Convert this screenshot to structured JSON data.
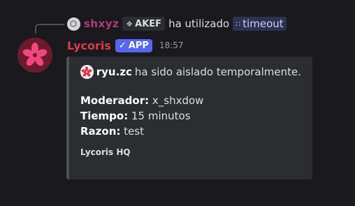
{
  "reply": {
    "username": "shxyz",
    "tag": "AKEF",
    "action_text": "ha utilizado",
    "command": "timeout",
    "avatar_icon": "user-avatar",
    "tag_icon": "clan-tag-icon",
    "command_icon": "slash-command-icon"
  },
  "message": {
    "username": "Lycoris",
    "app_badge": "APP",
    "timestamp": "18:57",
    "avatar_icon": "sakura-flower-icon",
    "username_color": "#e0384b"
  },
  "embed": {
    "title_user": "ryu.zc",
    "title_text": "ha sido aislado temporalmente.",
    "title_icon": "sakura-flower-icon",
    "fields": [
      {
        "key": "Moderador:",
        "value": "x_shxdow"
      },
      {
        "key": "Tiempo:",
        "value": "15 minutos"
      },
      {
        "key": "Razon:",
        "value": "test"
      }
    ],
    "footer": "Lycoris HQ",
    "border_color": "#4e5058"
  },
  "colors": {
    "background": "#1a1a1e",
    "app_badge": "#5865f2",
    "reply_username": "#b23a7a"
  }
}
